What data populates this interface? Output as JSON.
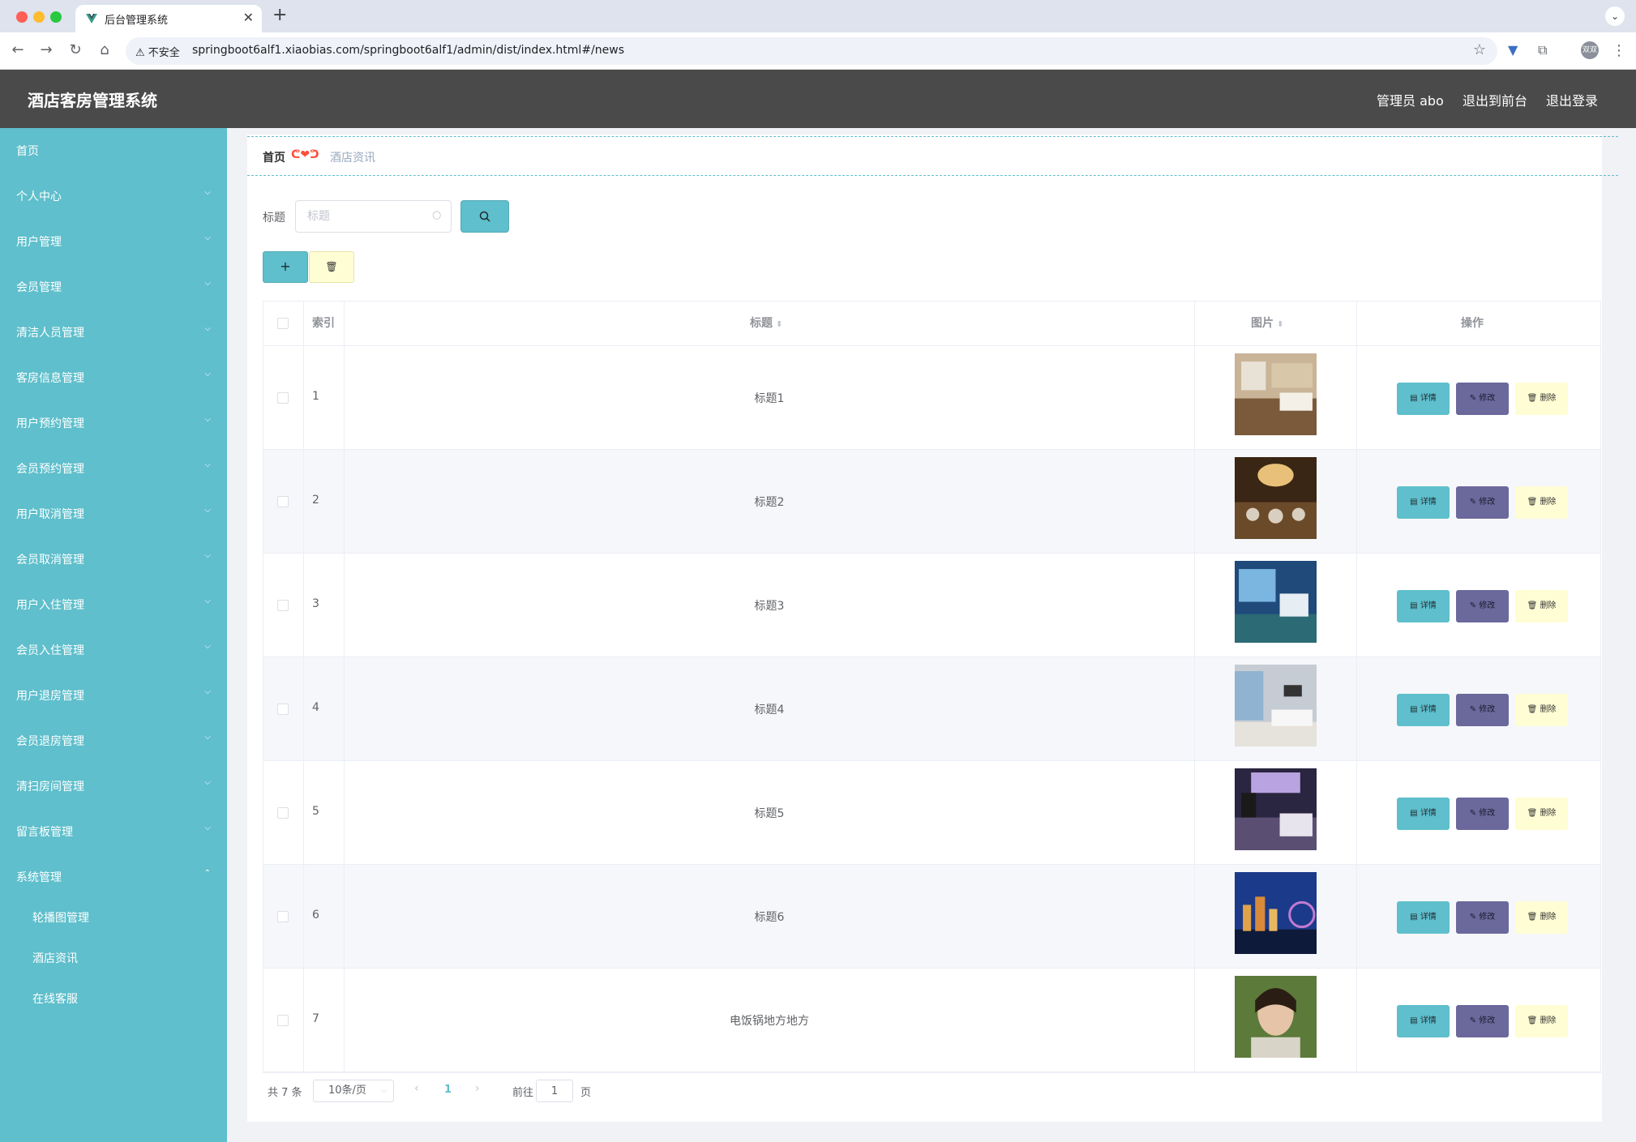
{
  "browser": {
    "tab_title": "后台管理系统",
    "insecure_label": "不安全",
    "url": "springboot6alf1.xiaobias.com/springboot6alf1/admin/dist/index.html#/news",
    "profile_label": "双双"
  },
  "header": {
    "title": "酒店客房管理系统",
    "user": "管理员 abo",
    "to_front": "退出到前台",
    "logout": "退出登录"
  },
  "sidebar": {
    "items": [
      {
        "label": "首页"
      },
      {
        "label": "个人中心"
      },
      {
        "label": "用户管理"
      },
      {
        "label": "会员管理"
      },
      {
        "label": "清洁人员管理"
      },
      {
        "label": "客房信息管理"
      },
      {
        "label": "用户预约管理"
      },
      {
        "label": "会员预约管理"
      },
      {
        "label": "用户取消管理"
      },
      {
        "label": "会员取消管理"
      },
      {
        "label": "用户入住管理"
      },
      {
        "label": "会员入住管理"
      },
      {
        "label": "用户退房管理"
      },
      {
        "label": "会员退房管理"
      },
      {
        "label": "清扫房间管理"
      },
      {
        "label": "留言板管理"
      },
      {
        "label": "系统管理"
      }
    ],
    "sub_items": [
      {
        "label": "轮播图管理"
      },
      {
        "label": "酒店资讯"
      },
      {
        "label": "在线客服"
      }
    ]
  },
  "breadcrumb": {
    "home": "首页",
    "separator": "ᕦ❤ᕤ",
    "current": "酒店资讯"
  },
  "search": {
    "label": "标题",
    "placeholder": "标题"
  },
  "table": {
    "headers": {
      "index": "索引",
      "title": "标题",
      "image": "图片",
      "actions": "操作"
    },
    "action_labels": {
      "detail": "详情",
      "edit": "修改",
      "delete": "删除"
    },
    "rows": [
      {
        "index": "1",
        "title": "标题1"
      },
      {
        "index": "2",
        "title": "标题2"
      },
      {
        "index": "3",
        "title": "标题3"
      },
      {
        "index": "4",
        "title": "标题4"
      },
      {
        "index": "5",
        "title": "标题5"
      },
      {
        "index": "6",
        "title": "标题6"
      },
      {
        "index": "7",
        "title": "电饭锅地方地方"
      }
    ]
  },
  "pagination": {
    "total": "共 7 条",
    "page_size": "10条/页",
    "current_page": "1",
    "goto_label": "前往",
    "goto_value": "1",
    "page_suffix": "页"
  },
  "colors": {
    "accent": "#5fbfcc",
    "header_bg": "#4a4a4a",
    "edit_button": "#6b689c",
    "delete_button": "#fffdd4"
  }
}
